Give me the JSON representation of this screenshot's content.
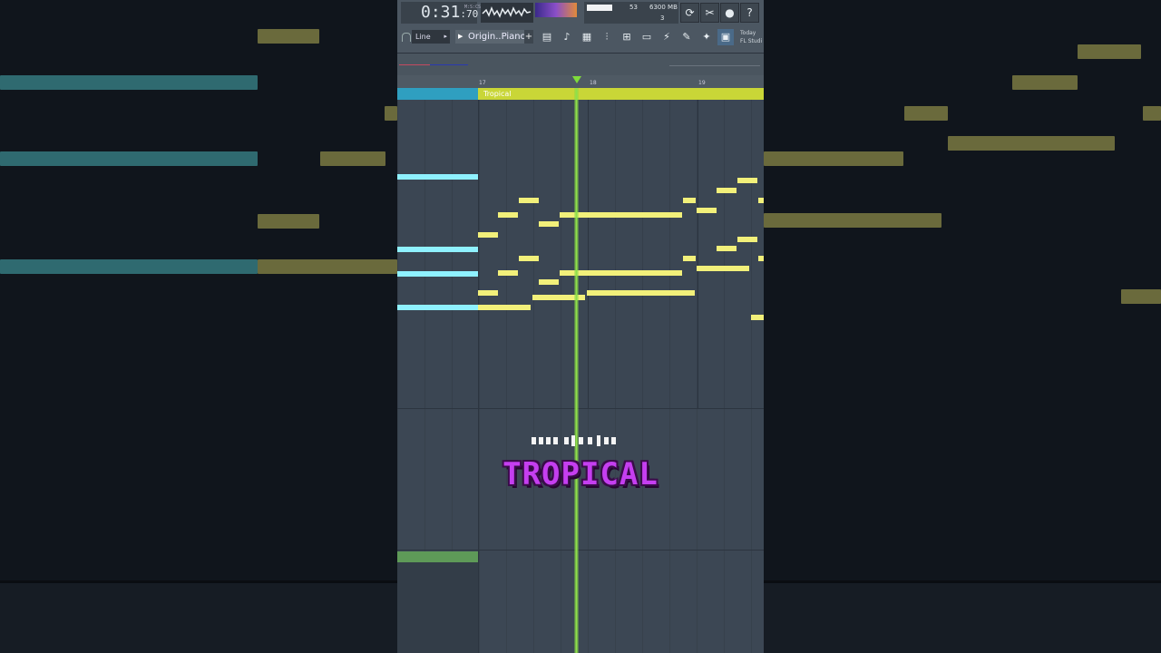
{
  "transport": {
    "time_main": "0:31",
    "time_sub": ":70",
    "time_unit": "M:S:CS"
  },
  "cpu": {
    "poly": "53",
    "memory": "6300 MB",
    "voices": "3"
  },
  "toolbar_row2": {
    "snap_label": "Line",
    "instrument_label": "Origin..Piano:",
    "add_label": "+",
    "news_line1": "Today",
    "news_line2": "FL Studi"
  },
  "ruler": {
    "bar17": "17",
    "bar18": "18",
    "bar19": "19"
  },
  "pattern": {
    "label": "Tropical"
  },
  "overlay": {
    "title": "TROPICAL"
  },
  "colors": {
    "note": "#f2f07a",
    "ghost_note": "#8ff1ff",
    "playhead": "#8fe04a",
    "pattern": "#c9d637",
    "overlay_title": "#c53ef0"
  }
}
